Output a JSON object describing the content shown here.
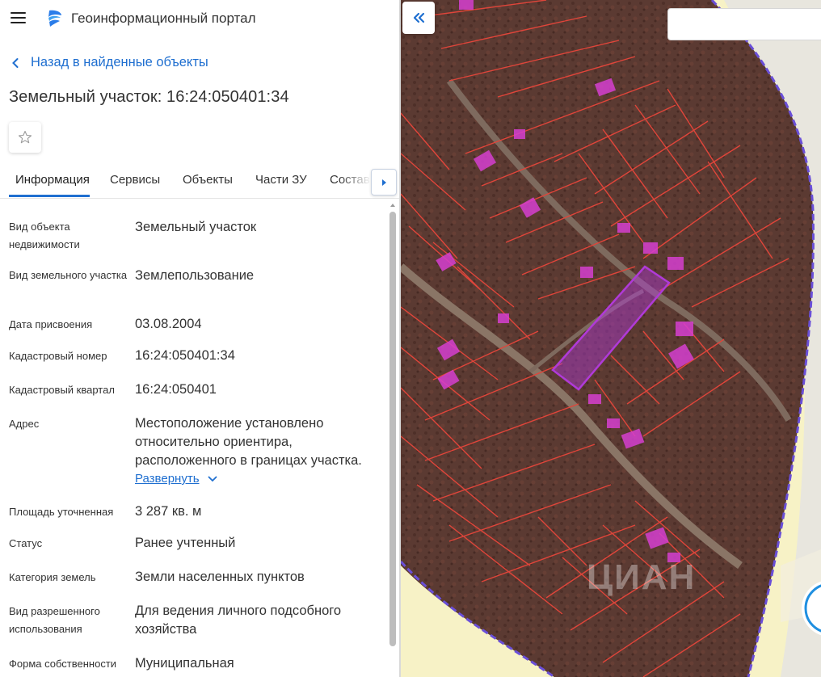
{
  "app": {
    "title": "Геоинформационный портал"
  },
  "nav": {
    "back_label": "Назад в найденные объекты"
  },
  "page": {
    "title": "Земельный участок: 16:24:050401:34"
  },
  "tabs": [
    {
      "label": "Информация",
      "active": true
    },
    {
      "label": "Сервисы"
    },
    {
      "label": "Объекты"
    },
    {
      "label": "Части ЗУ"
    },
    {
      "label": "Состав"
    }
  ],
  "fields": [
    {
      "label": "Вид объекта недвижимости",
      "value": "Земельный участок"
    },
    {
      "label": "Вид земельного участка",
      "value": "Землепользование"
    },
    {
      "label": "Дата присвоения",
      "value": "03.08.2004"
    },
    {
      "label": "Кадастровый номер",
      "value": "16:24:050401:34"
    },
    {
      "label": "Кадастровый квартал",
      "value": "16:24:050401"
    },
    {
      "label": "Адрес",
      "value": "Местоположение установлено относительно ориентира, расположенного в границах участка."
    },
    {
      "label": "Площадь уточненная",
      "value": "3 287 кв. м"
    },
    {
      "label": "Статус",
      "value": "Ранее учтенный"
    },
    {
      "label": "Категория земель",
      "value": "Земли населенных пунктов"
    },
    {
      "label": "Вид разрешенного использования",
      "value": "Для ведения личного подсобного хозяйства"
    },
    {
      "label": "Форма собственности",
      "value": "Муниципальная"
    }
  ],
  "address_expand_label": "Развернуть",
  "map": {
    "search_placeholder": "",
    "watermark": "ЦИАН"
  },
  "colors": {
    "accent": "#1f6fd0",
    "parcel_border": "#e0453a",
    "selected_parcel": "#b03ad8",
    "building": "#d63fd0",
    "boundary_line": "#6a4fd8"
  }
}
